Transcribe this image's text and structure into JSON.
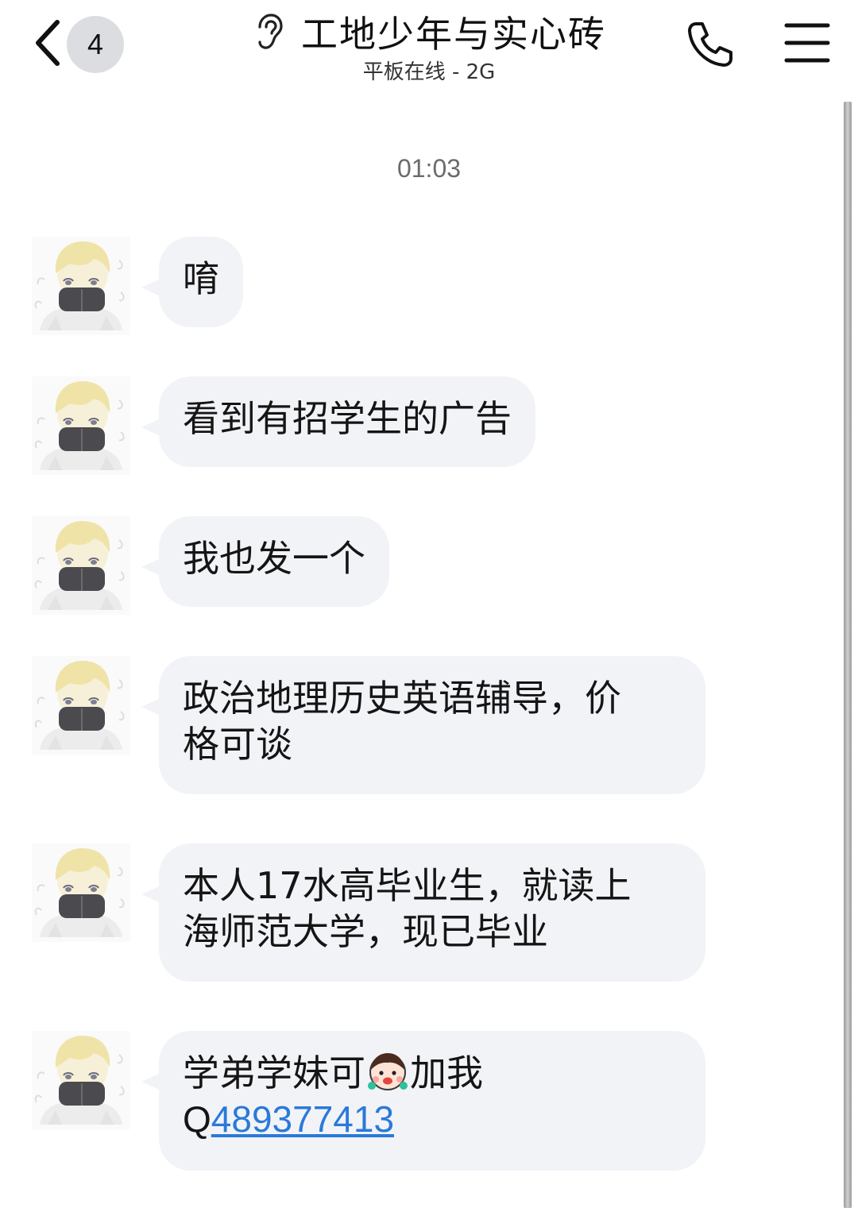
{
  "header": {
    "unread_count": "4",
    "title": "工地少年与实心砖",
    "subtitle": "平板在线 - 2G"
  },
  "conversation": {
    "timestamp": "01:03",
    "messages": [
      {
        "text": "唷"
      },
      {
        "text": "看到有招学生的广告"
      },
      {
        "text": "我也发一个"
      },
      {
        "line1": "政治地理历史英语辅导，价",
        "line2": "格可谈"
      },
      {
        "line1": "本人17水高毕业生，就读上",
        "line2": "海师范大学，现已毕业"
      },
      {
        "line1_before": "学弟学妹可",
        "line1_after": "加我",
        "q_prefix": "Q",
        "qq_number": "489377413"
      }
    ]
  },
  "icons": {
    "back": "chevron-left-icon",
    "ear": "ear-icon",
    "call": "phone-icon",
    "menu": "hamburger-menu-icon",
    "emoji": "smiley-emoji-icon"
  },
  "colors": {
    "bubble": "#f2f3f7",
    "link": "#2a7ad8",
    "badge": "#dcdde1"
  }
}
